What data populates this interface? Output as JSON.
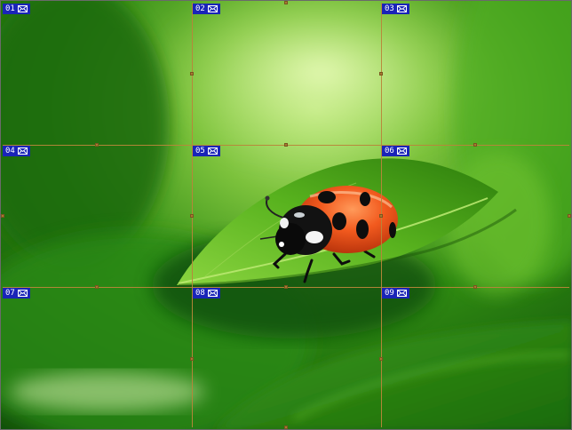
{
  "image": {
    "subject": "ladybug on leaf",
    "grid": {
      "rows": 3,
      "columns": 3,
      "line_color": "#b8863a"
    }
  },
  "tiles": [
    {
      "number": "01",
      "icon": "envelope-icon"
    },
    {
      "number": "02",
      "icon": "envelope-icon"
    },
    {
      "number": "03",
      "icon": "envelope-icon"
    },
    {
      "number": "04",
      "icon": "envelope-icon"
    },
    {
      "number": "05",
      "icon": "envelope-icon"
    },
    {
      "number": "06",
      "icon": "envelope-icon"
    },
    {
      "number": "07",
      "icon": "envelope-icon"
    },
    {
      "number": "08",
      "icon": "envelope-icon"
    },
    {
      "number": "09",
      "icon": "envelope-icon"
    }
  ],
  "colors": {
    "label_bg": "#1a24b8",
    "label_text": "#ffffff"
  }
}
